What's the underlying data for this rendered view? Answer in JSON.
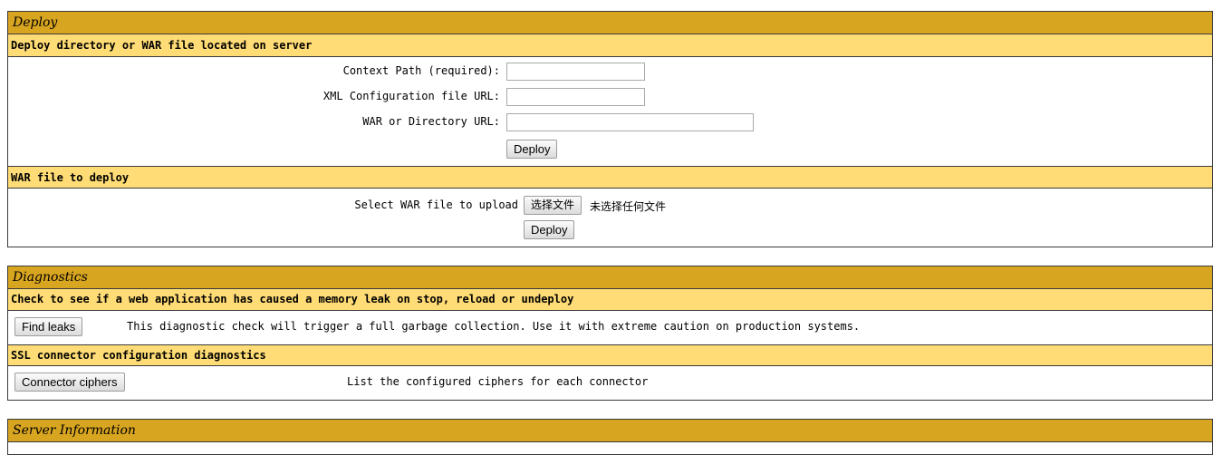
{
  "deploy": {
    "title": "Deploy",
    "server_heading": "Deploy directory or WAR file located on server",
    "context_path_label": "Context Path (required):",
    "context_path_value": "",
    "xml_config_label": "XML Configuration file URL:",
    "xml_config_value": "",
    "war_dir_label": "WAR or Directory URL:",
    "war_dir_value": "",
    "deploy_button": "Deploy",
    "war_heading": "WAR file to deploy",
    "select_war_label": "Select WAR file to upload",
    "choose_file_button": "选择文件",
    "no_file_text": "未选择任何文件",
    "upload_deploy_button": "Deploy"
  },
  "diagnostics": {
    "title": "Diagnostics",
    "leak_heading": "Check to see if a web application has caused a memory leak on stop, reload or undeploy",
    "find_leaks_button": "Find leaks",
    "find_leaks_desc": "This diagnostic check will trigger a full garbage collection. Use it with extreme caution on production systems.",
    "ssl_heading": "SSL connector configuration diagnostics",
    "connector_ciphers_button": "Connector ciphers",
    "connector_ciphers_desc": "List the configured ciphers for each connector"
  },
  "server_info": {
    "title": "Server Information"
  }
}
